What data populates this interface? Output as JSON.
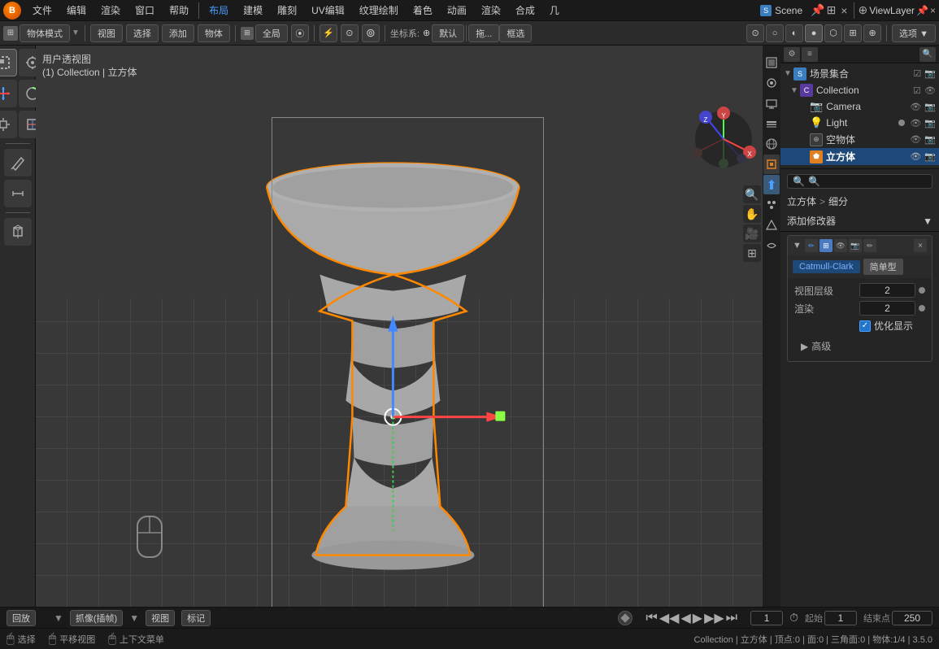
{
  "app": {
    "title": "Blender",
    "scene_name": "Scene",
    "view_layer": "ViewLayer"
  },
  "menubar": {
    "logo": "B",
    "items": [
      "文件",
      "编辑",
      "渲染",
      "窗口",
      "帮助",
      "布局",
      "建模",
      "雕刻",
      "UV编辑",
      "纹理绘制",
      "着色",
      "动画",
      "渲染",
      "合成",
      "几"
    ]
  },
  "toolbar2": {
    "mode_btn": "物体模式",
    "view_btn": "视图",
    "select_btn": "选择",
    "add_btn": "添加",
    "object_btn": "物体",
    "transform_label": "全局",
    "coord_label": "框选",
    "proportional_btn": "⊙",
    "options_btn": "选项 ▼"
  },
  "viewport": {
    "label": "用户透视图",
    "collection_label": "(1) Collection | 立方体"
  },
  "scene_tree": {
    "scene_label": "场景集合",
    "collection_label": "Collection",
    "items": [
      {
        "name": "Camera",
        "icon": "📷",
        "indent": 2,
        "visible": true,
        "selected": false
      },
      {
        "name": "Light",
        "icon": "💡",
        "indent": 2,
        "visible": true,
        "selected": false,
        "dot": true
      },
      {
        "name": "空物体",
        "icon": "📦",
        "indent": 2,
        "visible": true,
        "selected": false
      },
      {
        "name": "立方体",
        "icon": "🔷",
        "indent": 2,
        "visible": true,
        "selected": true
      }
    ]
  },
  "modifier_panel": {
    "breadcrumb": [
      "立方体",
      ">",
      "细分"
    ],
    "search_placeholder": "🔍",
    "add_modifier_label": "添加修改器",
    "modifier": {
      "type_label": "Catmull-Clark",
      "type_alt": "简单型",
      "props": [
        {
          "label": "视图层级",
          "value": "2"
        },
        {
          "label": "渲染",
          "value": "2"
        }
      ],
      "checkbox_label": "优化显示",
      "checkbox_checked": true,
      "advanced_label": "高级"
    }
  },
  "props_icons": [
    "🔧",
    "⚡",
    "🎨",
    "📐",
    "🔩",
    "⭕",
    "🌊",
    "✨",
    "🎯"
  ],
  "timeline": {
    "playback_label": "回放",
    "interp_label": "抓像(插帧)",
    "view_label": "视图",
    "marker_label": "标记",
    "current_frame": "1",
    "start_frame": "1",
    "end_frame": "250",
    "start_label": "起始",
    "end_label": "结束点"
  },
  "statusbar": {
    "select_label": "选择",
    "move_label": "平移视图",
    "context_label": "上下文菜单",
    "collection_info": "Collection | 立方体 | 顶点:0 | 面:0 | 三角面:0 | 物体:1/4 | 3.5.0"
  },
  "icons": {
    "arrow_right": "▶",
    "arrow_down": "▼",
    "arrow_left": "◀",
    "check": "✓",
    "plus": "+",
    "minus": "-",
    "close": "×",
    "search": "🔍",
    "eye": "👁",
    "gear": "⚙",
    "camera": "📷",
    "light": "💡",
    "cube": "🟦",
    "wrench": "🔧"
  }
}
